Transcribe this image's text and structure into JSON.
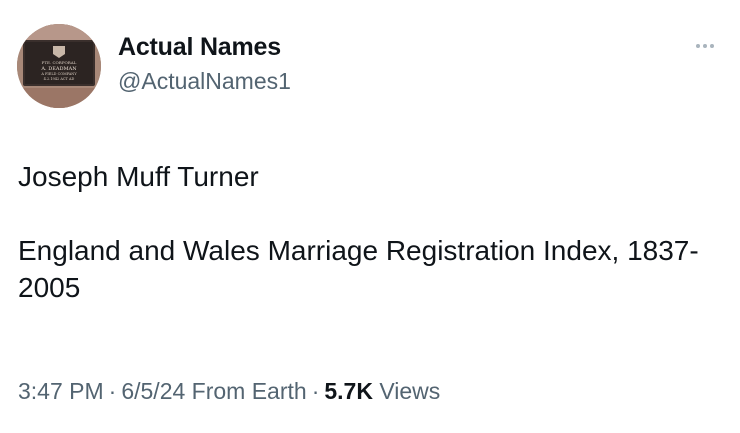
{
  "account": {
    "display_name": "Actual Names",
    "handle": "@ActualNames1",
    "avatar_plaque_lines": [
      "PTE. CORPORAL",
      "A. DEADMAN",
      "A FIELD COMPANY",
      "4.2.1942  ACT AD"
    ]
  },
  "menu": {
    "more_icon": "more-horizontal-icon"
  },
  "tweet": {
    "paragraphs": [
      "Joseph Muff Turner",
      "England and Wales Marriage Registration Index, 1837-2005"
    ]
  },
  "meta": {
    "time": "3:47 PM",
    "date": "6/5/24",
    "source": "From Earth",
    "separator": "·",
    "views_count": "5.7K",
    "views_label": "Views"
  },
  "colors": {
    "primary_text": "#0f1419",
    "secondary_text": "#536471",
    "background": "#ffffff"
  }
}
